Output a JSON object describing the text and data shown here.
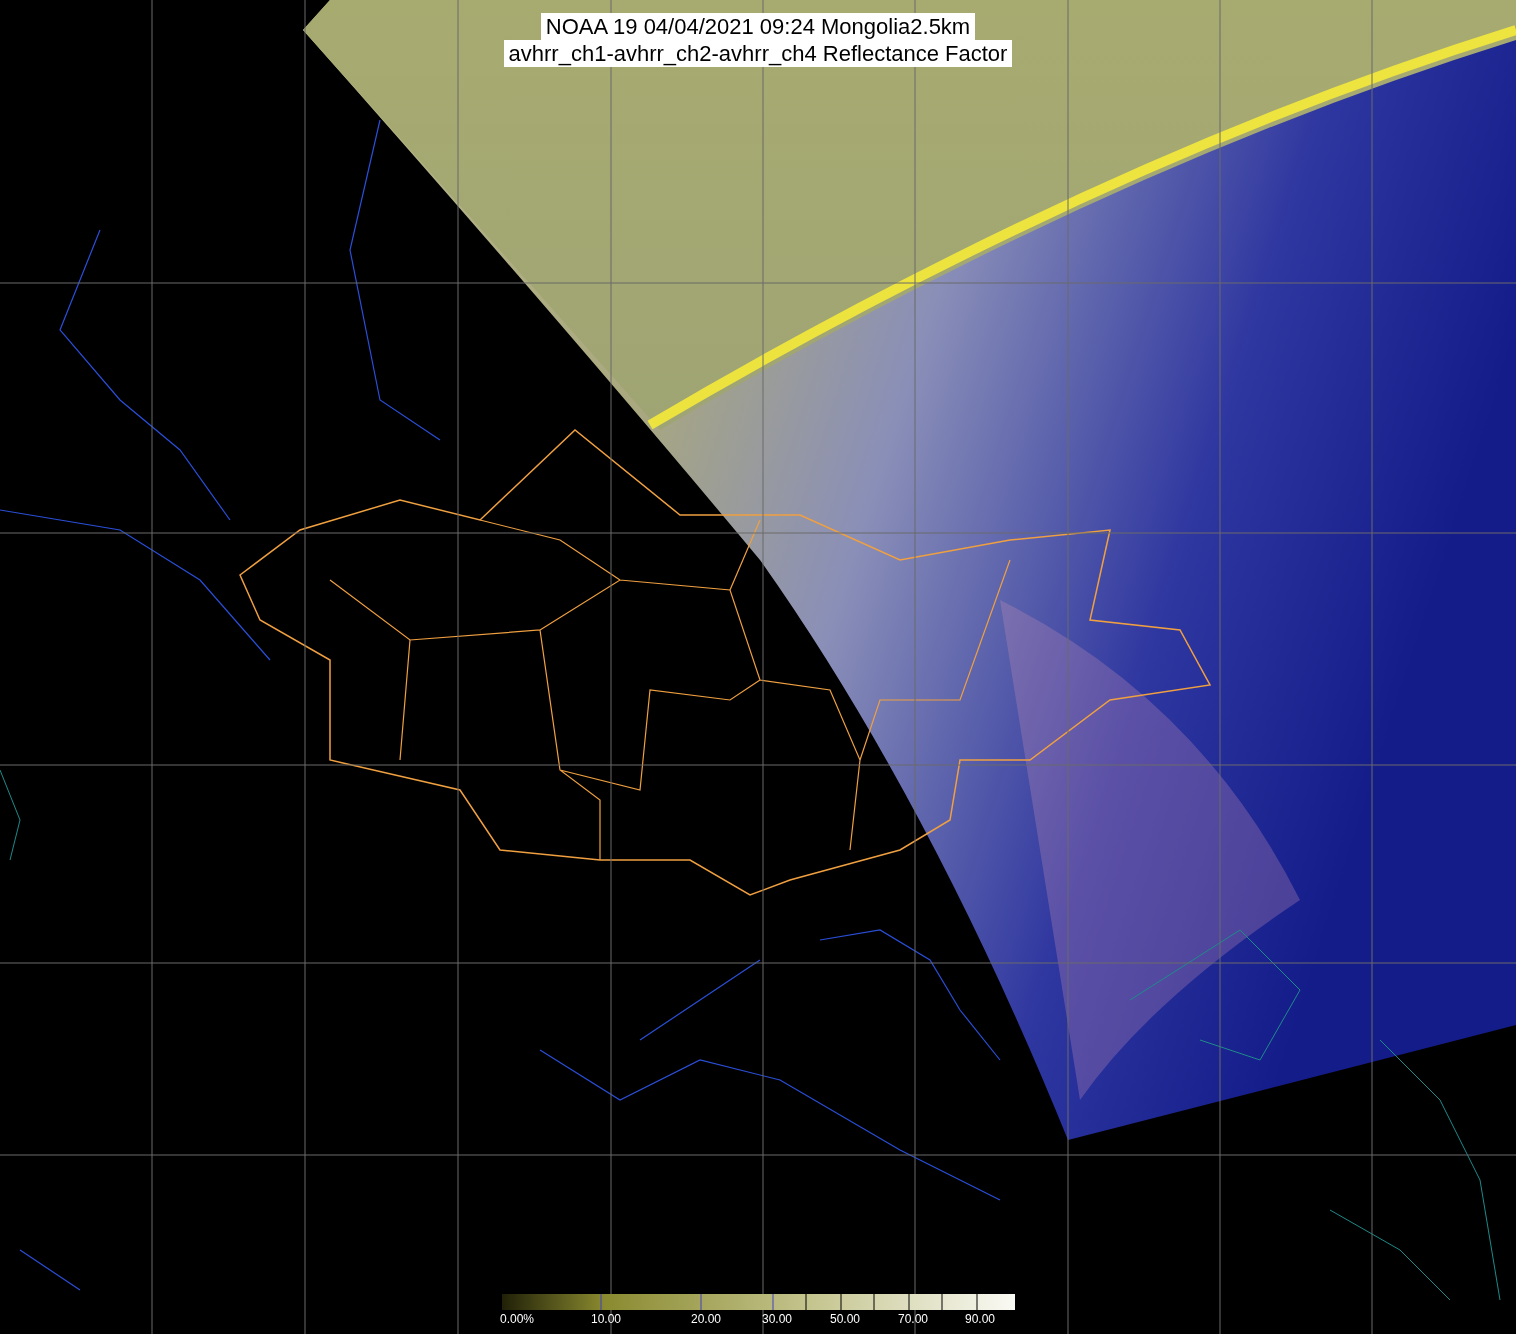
{
  "title": {
    "lines": [
      "NOAA 19 04/04/2021 09:24 Mongolia2.5km",
      "avhrr_ch1-avhrr_ch2-avhrr_ch4 Reflectance Factor"
    ]
  },
  "colorbar": {
    "labels": [
      "0.00%",
      "10.00",
      "20.00",
      "30.00",
      "50.00",
      "70.00",
      "90.00"
    ]
  }
}
